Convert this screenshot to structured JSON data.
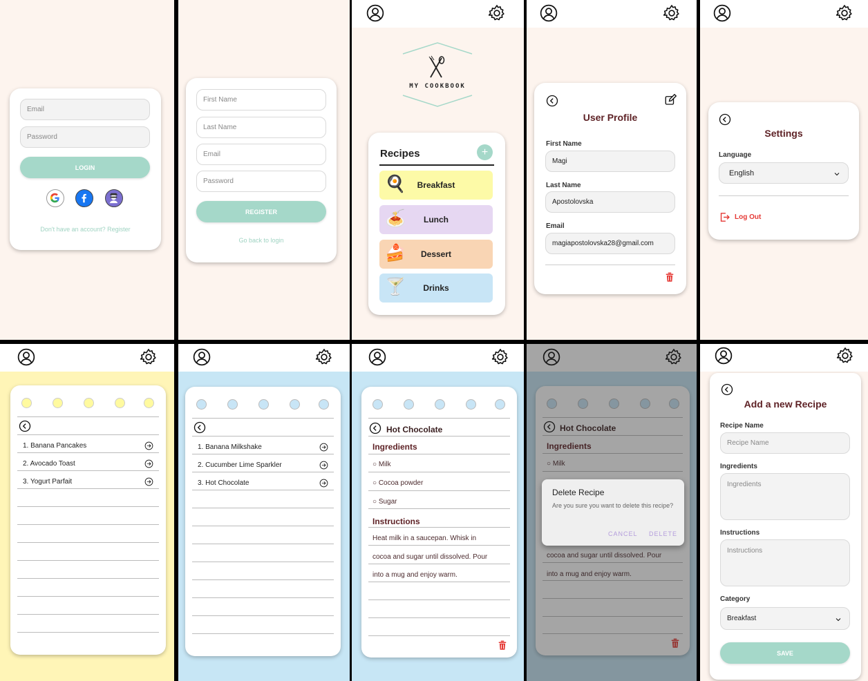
{
  "login": {
    "email_placeholder": "Email",
    "password_placeholder": "Password",
    "login_label": "LOGIN",
    "register_link": "Don't have an account? Register"
  },
  "register": {
    "first_name_placeholder": "First Name",
    "last_name_placeholder": "Last Name",
    "email_placeholder": "Email",
    "password_placeholder": "Password",
    "register_label": "REGISTER",
    "back_link": "Go back to login"
  },
  "home": {
    "logo_text": "MY COOKBOOK",
    "recipes_title": "Recipes",
    "categories": [
      {
        "label": "Breakfast",
        "color": "#fdfaa7"
      },
      {
        "label": "Lunch",
        "color": "#e6d7f2"
      },
      {
        "label": "Dessert",
        "color": "#f9d5b4"
      },
      {
        "label": "Drinks",
        "color": "#c8e5f6"
      }
    ]
  },
  "profile": {
    "title": "User Profile",
    "first_name_label": "First Name",
    "first_name_value": "Magi",
    "last_name_label": "Last Name",
    "last_name_value": "Apostolovska",
    "email_label": "Email",
    "email_value": "magiapostolovska28@gmail.com"
  },
  "settings": {
    "title": "Settings",
    "language_label": "Language",
    "language_value": "English",
    "logout_label": "Log Out"
  },
  "breakfast_list": {
    "items": [
      "1. Banana Pancakes",
      "2. Avocado Toast",
      "3. Yogurt Parfait"
    ]
  },
  "drinks_list": {
    "items": [
      "1. Banana Milkshake",
      "2. Cucumber Lime Sparkler",
      "3. Hot Chocolate"
    ]
  },
  "recipe": {
    "name": "Hot Chocolate",
    "ingredients_title": "Ingredients",
    "ingredients": [
      "○ Milk",
      "○ Cocoa powder",
      "○ Sugar"
    ],
    "instructions_title": "Instructions",
    "instructions_lines": [
      "Heat milk in a saucepan. Whisk in",
      "cocoa and sugar until dissolved. Pour",
      "into a mug and enjoy warm."
    ]
  },
  "delete_dialog": {
    "title": "Delete Recipe",
    "message": "Are you sure you want to delete this recipe?",
    "cancel_label": "CANCEL",
    "delete_label": "DELETE"
  },
  "add_recipe": {
    "title": "Add a new Recipe",
    "name_label": "Recipe Name",
    "name_placeholder": "Recipe Name",
    "ingredients_label": "Ingredients",
    "ingredients_placeholder": "Ingredients",
    "instructions_label": "Instructions",
    "instructions_placeholder": "Instructions",
    "category_label": "Category",
    "category_value": "Breakfast",
    "save_label": "SAVE"
  },
  "colors": {
    "accent": "#a5d8c9",
    "brand": "#5e2226",
    "background": "#fdf4ee",
    "delete": "#e53935"
  }
}
